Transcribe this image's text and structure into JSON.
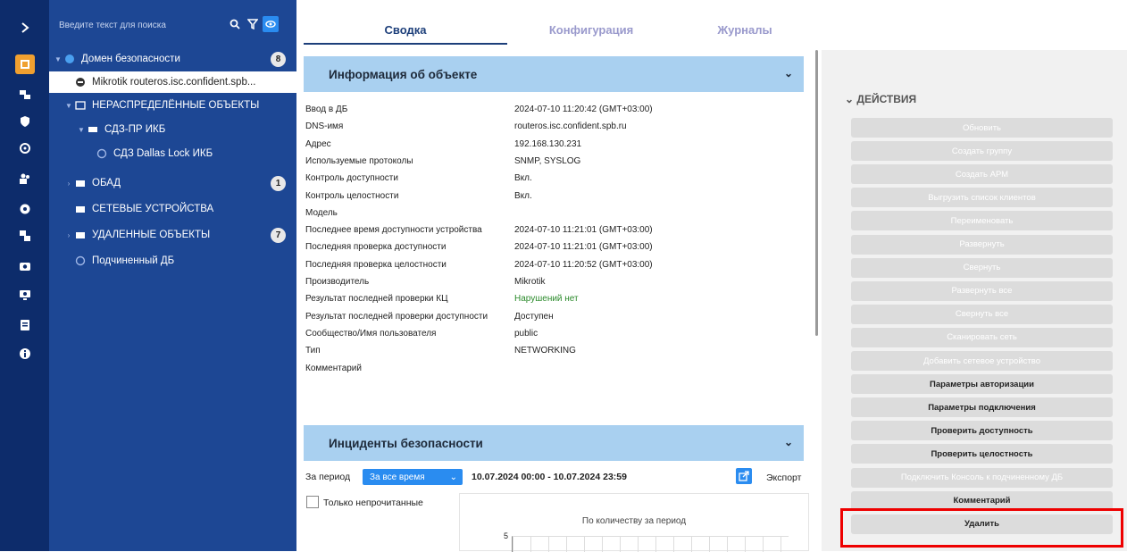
{
  "sidebar_rail": {
    "items": [
      {
        "icon": "chevron-right-icon"
      },
      {
        "icon": "domain-icon",
        "active": true
      },
      {
        "icon": "devices-icon"
      },
      {
        "icon": "shield-icon"
      },
      {
        "icon": "settings-cog-icon"
      },
      {
        "icon": "users-icon"
      },
      {
        "icon": "gear-icon"
      },
      {
        "icon": "network-icon"
      },
      {
        "icon": "camera-icon"
      },
      {
        "icon": "monitor-icon"
      },
      {
        "icon": "document-icon"
      },
      {
        "icon": "info-icon"
      }
    ]
  },
  "search": {
    "placeholder": "Введите текст для поиска"
  },
  "tree": [
    {
      "label": "Домен безопасности",
      "badge": "8"
    },
    {
      "label": "Mikrotik routeros.isc.confident.spb..."
    },
    {
      "label": "НЕРАСПРЕДЕЛЁННЫЕ ОБЪЕКТЫ"
    },
    {
      "label": "СДЗ-ПР ИКБ"
    },
    {
      "label": "СДЗ Dallas Lock ИКБ"
    },
    {
      "label": "ОБАД",
      "badge": "1"
    },
    {
      "label": "СЕТЕВЫЕ УСТРОЙСТВА"
    },
    {
      "label": "УДАЛЕННЫЕ ОБЪЕКТЫ",
      "badge": "7"
    },
    {
      "label": "Подчиненный ДБ"
    }
  ],
  "tabs": [
    "Сводка",
    "Конфигурация",
    "Журналы"
  ],
  "object_info": {
    "title": "Информация об объекте",
    "rows": [
      {
        "k": "Ввод в ДБ",
        "v": "2024-07-10 11:20:42 (GMT+03:00)"
      },
      {
        "k": "DNS-имя",
        "v": "routeros.isc.confident.spb.ru"
      },
      {
        "k": "Адрес",
        "v": "192.168.130.231"
      },
      {
        "k": "Используемые протоколы",
        "v": "SNMP, SYSLOG"
      },
      {
        "k": "Контроль доступности",
        "v": "Вкл."
      },
      {
        "k": "Контроль целостности",
        "v": "Вкл."
      },
      {
        "k": "Модель",
        "v": ""
      },
      {
        "k": "Последнее время доступности устройства",
        "v": "2024-07-10 11:21:01 (GMT+03:00)"
      },
      {
        "k": "Последняя проверка доступности",
        "v": "2024-07-10 11:21:01 (GMT+03:00)"
      },
      {
        "k": "Последняя проверка целостности",
        "v": "2024-07-10 11:20:52 (GMT+03:00)"
      },
      {
        "k": "Производитель",
        "v": "Mikrotik"
      },
      {
        "k": "Результат последней проверки КЦ",
        "v": "Нарушений нет",
        "color": "#2a8a2a"
      },
      {
        "k": "Результат последней проверки доступности",
        "v": "Доступен"
      },
      {
        "k": "Сообщество/Имя пользователя",
        "v": "public"
      },
      {
        "k": "Тип",
        "v": "NETWORKING"
      },
      {
        "k": "Комментарий",
        "v": ""
      }
    ]
  },
  "incidents": {
    "title": "Инциденты безопасности",
    "period_label": "За период",
    "period_value": "За все время",
    "date_range": "10.07.2024 00:00 - 10.07.2024 23:59",
    "export_label": "Экспорт",
    "unread_only_label": "Только непрочитанные",
    "chart_title": "По количеству за период",
    "chart_ytick": "5"
  },
  "actions": {
    "title": "ДЕЙСТВИЯ",
    "buttons": [
      {
        "label": "Обновить",
        "state": "dim"
      },
      {
        "label": "Создать группу",
        "state": "disabled"
      },
      {
        "label": "Создать АРМ",
        "state": "disabled"
      },
      {
        "label": "Выгрузить список клиентов",
        "state": "disabled"
      },
      {
        "label": "Переименовать",
        "state": "disabled"
      },
      {
        "label": "Развернуть",
        "state": "disabled"
      },
      {
        "label": "Свернуть",
        "state": "disabled"
      },
      {
        "label": "Развернуть все",
        "state": "disabled"
      },
      {
        "label": "Свернуть все",
        "state": "disabled"
      },
      {
        "label": "Сканировать сеть",
        "state": "disabled"
      },
      {
        "label": "Добавить сетевое устройство",
        "state": "disabled"
      },
      {
        "label": "Параметры авторизации",
        "state": "enabled"
      },
      {
        "label": "Параметры подключения",
        "state": "enabled"
      },
      {
        "label": "Проверить доступность",
        "state": "enabled"
      },
      {
        "label": "Проверить целостность",
        "state": "enabled"
      },
      {
        "label": "Подключить Консоль к подчиненному ДБ",
        "state": "disabled"
      },
      {
        "label": "Комментарий",
        "state": "enabled"
      },
      {
        "label": "Удалить",
        "state": "enabled"
      }
    ]
  },
  "colors": {
    "rail": "#0d2c6b",
    "tree": "#1d4794",
    "accent": "#f0a030",
    "panel_header": "#a9d0f0",
    "highlight": "#ee0000"
  }
}
